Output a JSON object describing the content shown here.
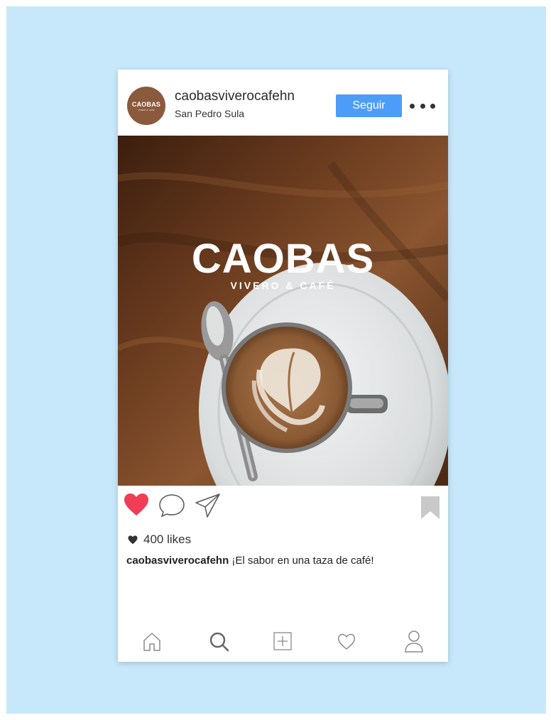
{
  "post": {
    "avatar": {
      "text": "CAOBAS",
      "subtext": "VIVERO & CAFÉ"
    },
    "username": "caobasviverocafehn",
    "location": "San Pedro Sula",
    "follow_label": "Seguir",
    "image": {
      "brand_name": "CAOBAS",
      "brand_tagline": "VIVERO & CAFÉ"
    },
    "likes": "400 likes",
    "caption_user": "caobasviverocafehn",
    "caption_text": "¡El sabor en una taza de café!",
    "liked": true
  },
  "icons": {
    "more": "more-icon",
    "like": "heart-icon",
    "comment": "comment-icon",
    "share": "send-icon",
    "save": "bookmark-icon",
    "nav": [
      "home-icon",
      "search-icon",
      "add-icon",
      "activity-icon",
      "profile-icon"
    ]
  },
  "colors": {
    "background": "#c7e8fb",
    "follow_button": "#4d9cf8",
    "like": "#f23d56",
    "avatar": "#8b5a3c"
  }
}
